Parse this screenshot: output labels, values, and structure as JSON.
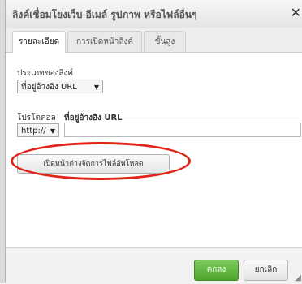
{
  "dialog": {
    "title": "ลิงค์เชื่อมโยงเว็บ อีเมล์ รูปภาพ หรือไฟล์อื่นๆ",
    "close_icon": "✕"
  },
  "tabs": [
    {
      "label": "รายละเอียด",
      "active": true
    },
    {
      "label": "การเปิดหน้าลิงค์",
      "active": false
    },
    {
      "label": "ขั้นสูง",
      "active": false
    }
  ],
  "link_type": {
    "label": "ประเภทของลิงค์",
    "value": "ที่อยู่อ้างอิง URL"
  },
  "protocol": {
    "label": "โปรโตคอล",
    "value": "http://"
  },
  "url": {
    "label": "ที่อยู่อ้างอิง URL",
    "value": ""
  },
  "browse_button": "เปิดหน้าต่างจัดการไฟล์อัพโหลด",
  "footer": {
    "ok_label": "ตกลง",
    "cancel_label": "ยกเลิก"
  },
  "colors": {
    "highlight": "#e2231a",
    "ok": "#4fa52e"
  }
}
